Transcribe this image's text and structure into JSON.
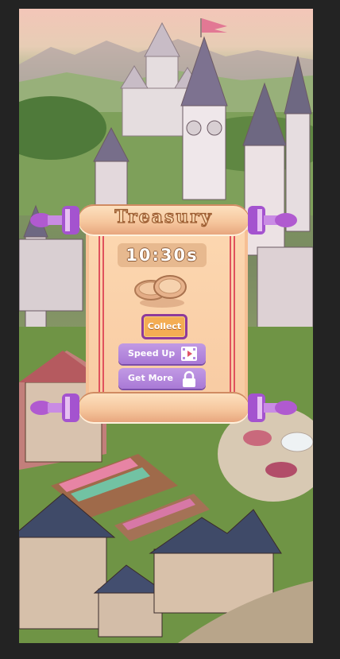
{
  "treasury": {
    "title": "Treasury",
    "timer": "10:30s",
    "collect_label": "Collect",
    "speed_up_label": "Speed Up",
    "get_more_label": "Get More"
  },
  "icons": {
    "coins": "coins-icon",
    "speed_up": "video-icon",
    "get_more": "lock-icon"
  },
  "colors": {
    "scroll_paper": "#fcd7b0",
    "collect_button": "#f4ad53",
    "purple_button": "#b58ae0",
    "scroll_handle": "#b06ad6"
  }
}
